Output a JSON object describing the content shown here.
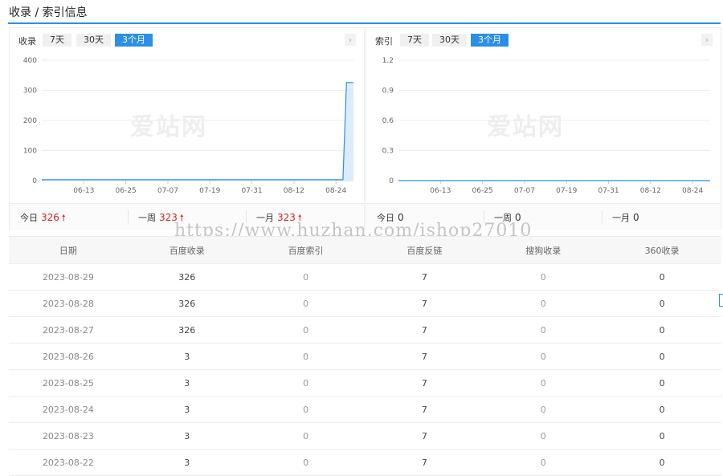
{
  "section_title": "收录 / 索引信息",
  "left_panel": {
    "label": "收录",
    "tabs": [
      "7天",
      "30天",
      "3个月"
    ],
    "active_tab": 2,
    "watermark": "爱站网",
    "stats": [
      {
        "label": "今日",
        "value": "326",
        "trend": "up"
      },
      {
        "label": "一周",
        "value": "323",
        "trend": "up"
      },
      {
        "label": "一月",
        "value": "323",
        "trend": "up"
      }
    ]
  },
  "right_panel": {
    "label": "索引",
    "tabs": [
      "7天",
      "30天",
      "3个月"
    ],
    "active_tab": 2,
    "watermark": "爱站网",
    "stats": [
      {
        "label": "今日",
        "value": "0"
      },
      {
        "label": "一周",
        "value": "0"
      },
      {
        "label": "一月",
        "value": "0"
      }
    ]
  },
  "chart_data": [
    {
      "type": "area",
      "x_ticks": [
        "06-13",
        "06-25",
        "07-07",
        "07-19",
        "07-31",
        "08-12",
        "08-24"
      ],
      "y_ticks": [
        "0",
        "100",
        "200",
        "300",
        "400"
      ],
      "ylim": [
        0,
        400
      ],
      "grid": true,
      "color": "#2b8fe8",
      "x": [
        "06-01",
        "06-13",
        "06-25",
        "07-07",
        "07-19",
        "07-31",
        "08-12",
        "08-24",
        "08-26",
        "08-27",
        "08-29"
      ],
      "values": [
        3,
        3,
        3,
        3,
        3,
        3,
        3,
        3,
        3,
        326,
        326
      ]
    },
    {
      "type": "line",
      "x_ticks": [
        "06-13",
        "06-25",
        "07-07",
        "07-19",
        "07-31",
        "08-12",
        "08-24"
      ],
      "y_ticks": [
        "0",
        "0.3",
        "0.6",
        "0.9",
        "1.2"
      ],
      "ylim": [
        0,
        1.2
      ],
      "grid": true,
      "color": "#2b8fe8",
      "x": [
        "06-01",
        "08-29"
      ],
      "values": [
        0,
        0
      ]
    }
  ],
  "url_watermark": "https://www.huzhan.com/ishop27010",
  "table": {
    "headers": [
      "日期",
      "百度收录",
      "百度索引",
      "百度反链",
      "搜狗收录",
      "360收录"
    ],
    "rows": [
      [
        "2023-08-29",
        "326",
        "0",
        "7",
        "0",
        "0"
      ],
      [
        "2023-08-28",
        "326",
        "0",
        "7",
        "0",
        "0"
      ],
      [
        "2023-08-27",
        "326",
        "0",
        "7",
        "0",
        "0"
      ],
      [
        "2023-08-26",
        "3",
        "0",
        "7",
        "0",
        "0"
      ],
      [
        "2023-08-25",
        "3",
        "0",
        "7",
        "0",
        "0"
      ],
      [
        "2023-08-24",
        "3",
        "0",
        "7",
        "0",
        "0"
      ],
      [
        "2023-08-23",
        "3",
        "0",
        "7",
        "0",
        "0"
      ],
      [
        "2023-08-22",
        "3",
        "0",
        "7",
        "0",
        "0"
      ]
    ]
  }
}
